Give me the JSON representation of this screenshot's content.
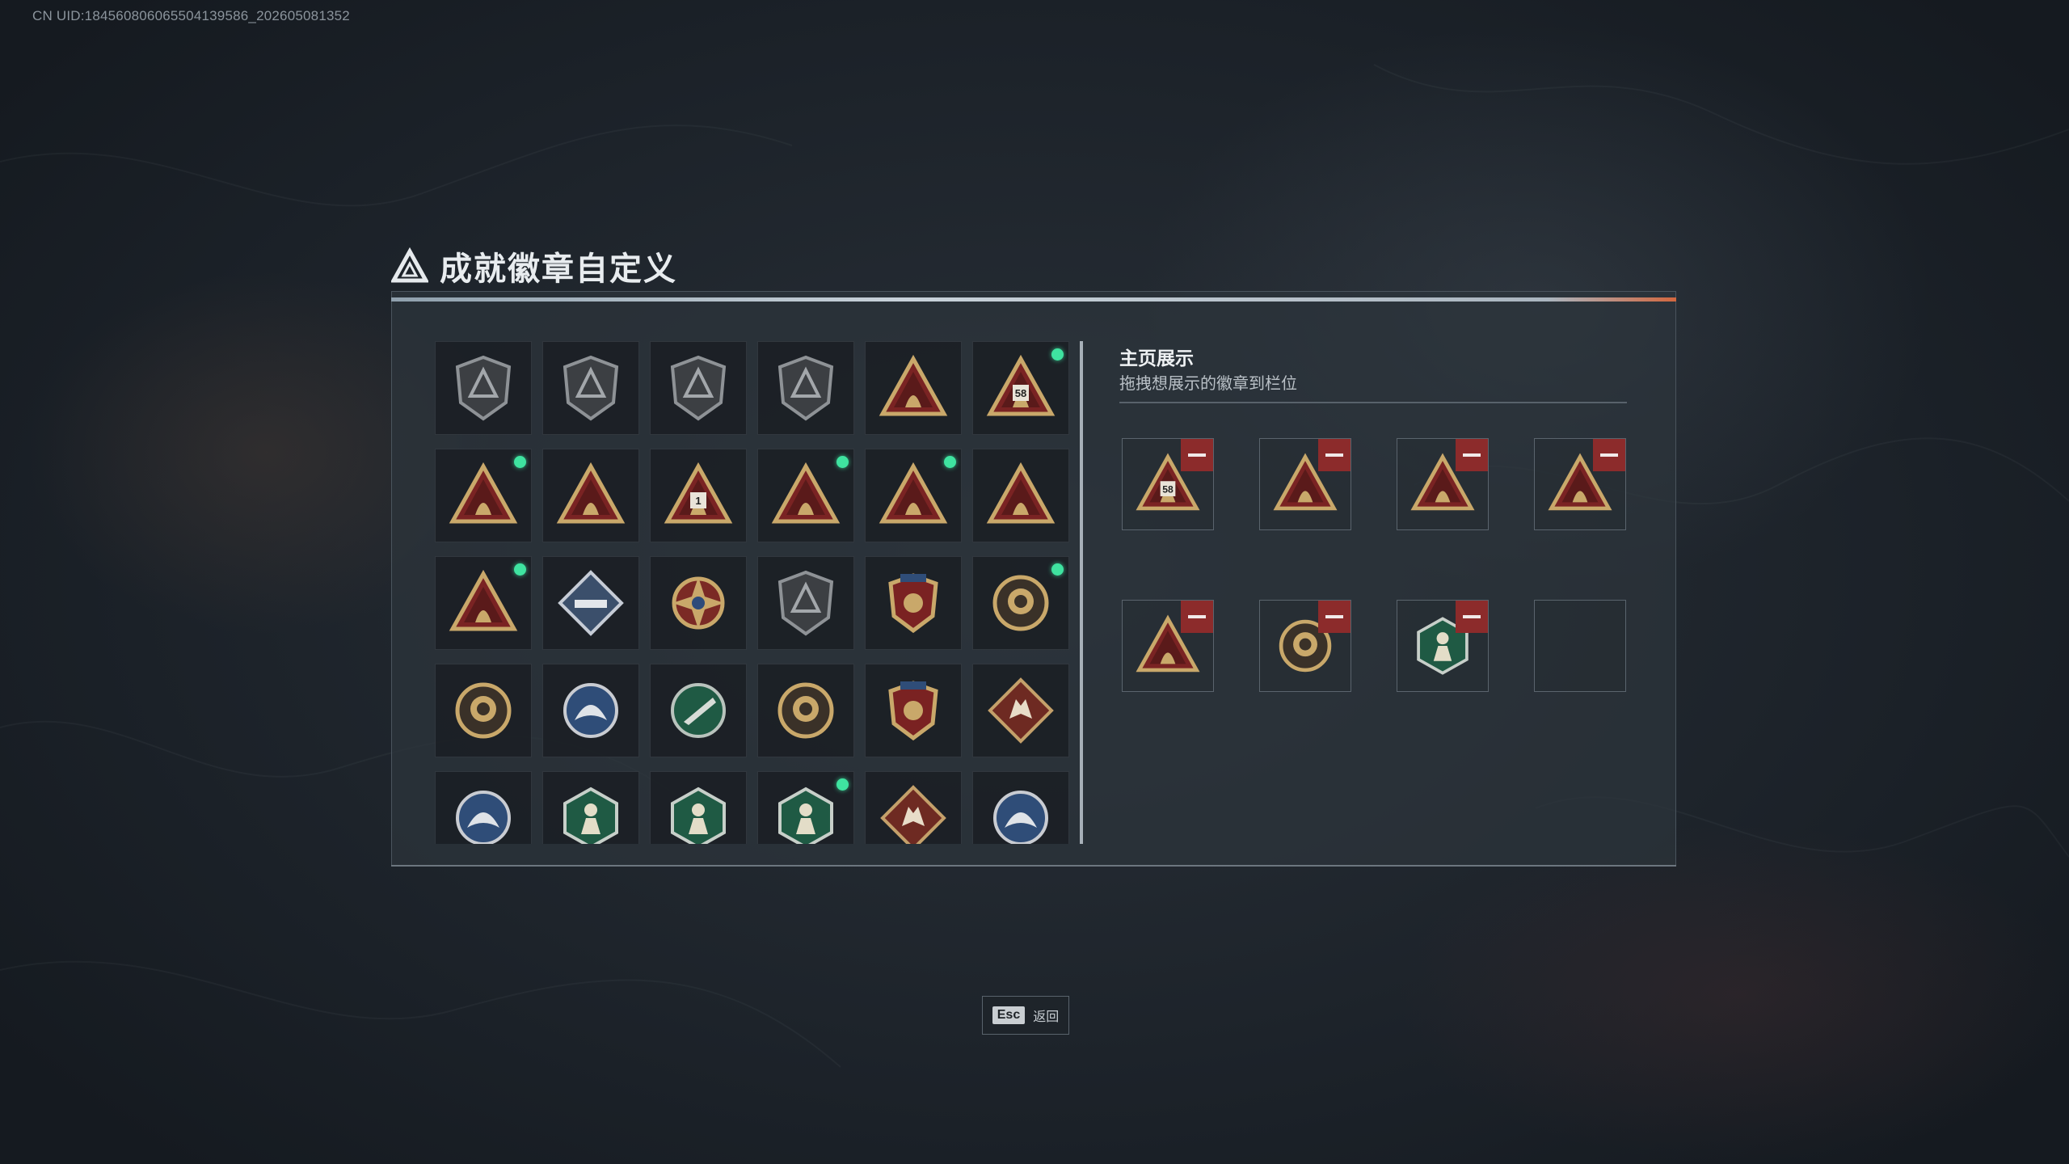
{
  "uid_text": "CN UID:184560806065504139586_202605081352",
  "title": "成就徽章自定义",
  "showcase": {
    "title": "主页展示",
    "subtitle": "拖拽想展示的徽章到栏位"
  },
  "esc": {
    "key": "Esc",
    "label": "返回"
  },
  "colors": {
    "new_dot": "#3fe3a0",
    "remove": "#8c2b2b",
    "gold": "#c9a86a",
    "red": "#7a2323",
    "green": "#1f5a44",
    "blue": "#2f4d78"
  },
  "badges": [
    {
      "icon": "shield-delta-badge-icon",
      "style": "gray-shield",
      "new": false
    },
    {
      "icon": "helicopter-badge-icon",
      "style": "gray-shield",
      "new": false
    },
    {
      "icon": "diamond-emblem-badge-icon",
      "style": "gray-shield",
      "new": false
    },
    {
      "icon": "dagger-shield-badge-icon",
      "style": "gray-shield",
      "new": false
    },
    {
      "icon": "vault-triangle-badge-icon",
      "style": "gold-red-triangle",
      "new": false
    },
    {
      "icon": "sign-58-badge-icon",
      "style": "gold-red-triangle",
      "new": true,
      "text": "58"
    },
    {
      "icon": "hand-sign-badge-icon",
      "style": "gold-red-triangle",
      "new": true
    },
    {
      "icon": "boat-badge-icon",
      "style": "gold-red-triangle",
      "new": false
    },
    {
      "icon": "number-one-badge-icon",
      "style": "gold-red-triangle",
      "new": false,
      "text": "1"
    },
    {
      "icon": "crate-badge-icon",
      "style": "gold-red-triangle",
      "new": true
    },
    {
      "icon": "runner-badge-icon",
      "style": "gold-red-triangle",
      "new": true
    },
    {
      "icon": "soldier-badge-icon",
      "style": "gold-red-triangle",
      "new": false
    },
    {
      "icon": "rocket-badge-icon",
      "style": "gold-red-triangle",
      "new": true
    },
    {
      "icon": "blue-diamond-gun-badge-icon",
      "style": "blue-diamond",
      "new": false
    },
    {
      "icon": "compass-star-badge-icon",
      "style": "gold-star",
      "new": false
    },
    {
      "icon": "shield-crest-badge-icon",
      "style": "gray-shield",
      "new": false
    },
    {
      "icon": "eagle-crest-badge-icon",
      "style": "crest",
      "new": false
    },
    {
      "icon": "helmet-round-badge-icon",
      "style": "gold-round",
      "new": true
    },
    {
      "icon": "skull-round-badge-icon",
      "style": "gold-round",
      "new": false
    },
    {
      "icon": "crosshair-rifle-badge-icon",
      "style": "blue-round",
      "new": false
    },
    {
      "icon": "green-rifle-badge-icon",
      "style": "green-round",
      "new": false
    },
    {
      "icon": "knife-round-badge-icon",
      "style": "gold-round",
      "new": false
    },
    {
      "icon": "gold-shield-crest-badge-icon",
      "style": "crest",
      "new": false
    },
    {
      "icon": "wolf-diamond-badge-icon",
      "style": "red-diamond",
      "new": false
    },
    {
      "icon": "blue-eagle-badge-icon",
      "style": "blue-round",
      "new": false
    },
    {
      "icon": "green-hornet-badge-icon",
      "style": "green-hex",
      "new": false
    },
    {
      "icon": "green-plane-badge-icon",
      "style": "green-hex",
      "new": false
    },
    {
      "icon": "green-soldier-badge-icon",
      "style": "green-hex",
      "new": true
    },
    {
      "icon": "red-dragon-badge-icon",
      "style": "red-diamond",
      "new": false
    },
    {
      "icon": "blue-wolf-badge-icon",
      "style": "blue-round",
      "new": false
    }
  ],
  "slots": [
    {
      "icon": "sign-58-badge-icon",
      "style": "gold-red-triangle",
      "filled": true,
      "text": "58"
    },
    {
      "icon": "rocket-badge-icon",
      "style": "gold-red-triangle",
      "filled": true
    },
    {
      "icon": "crate-badge-icon",
      "style": "gold-red-triangle",
      "filled": true
    },
    {
      "icon": "runner-badge-icon",
      "style": "gold-red-triangle",
      "filled": true
    },
    {
      "icon": "hand-sign-badge-icon",
      "style": "gold-red-triangle",
      "filled": true
    },
    {
      "icon": "helmet-round-badge-icon",
      "style": "gold-round",
      "filled": true
    },
    {
      "icon": "green-soldier-badge-icon",
      "style": "green-hex",
      "filled": true
    },
    {
      "icon": "empty-slot",
      "style": "empty",
      "filled": false
    }
  ]
}
